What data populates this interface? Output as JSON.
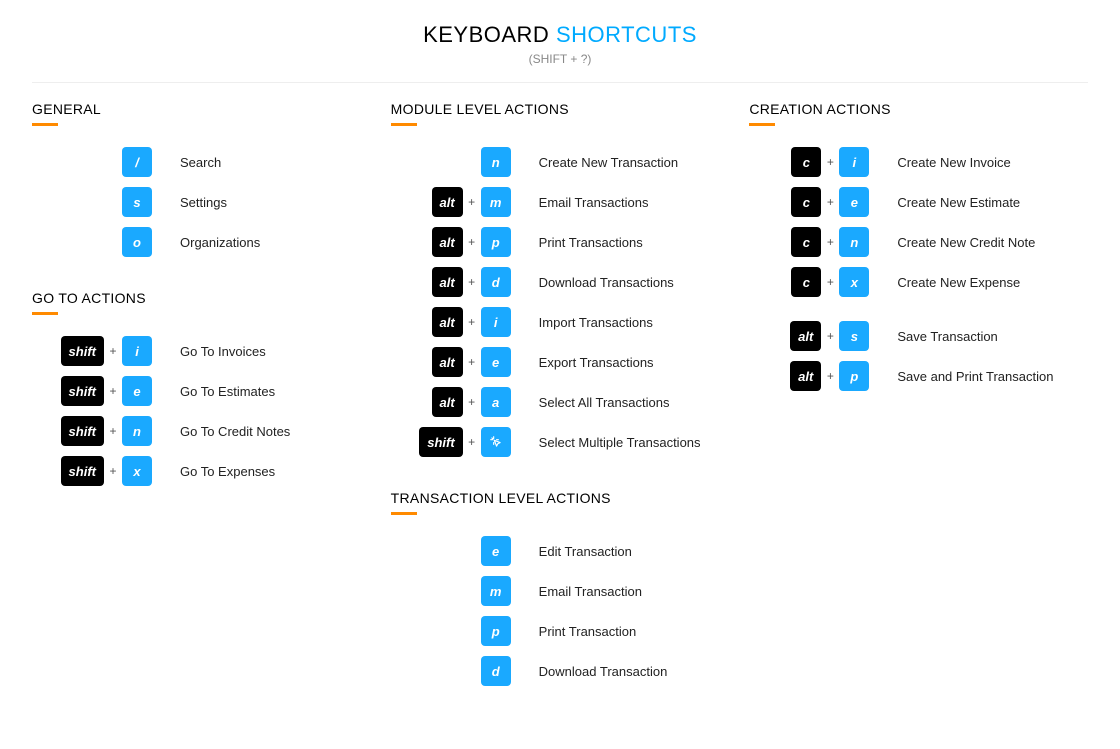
{
  "title_part1": "KEYBOARD ",
  "title_part2": "SHORTCUTS",
  "subtitle": "(SHIFT + ?)",
  "plus": "+",
  "keys": {
    "shift": "shift",
    "alt": "alt",
    "c": "c",
    "slash": "/",
    "s": "s",
    "o": "o",
    "i": "i",
    "e": "e",
    "n": "n",
    "x": "x",
    "m": "m",
    "p": "p",
    "d": "d",
    "a": "a"
  },
  "sections": {
    "general": {
      "title": "GENERAL",
      "items": [
        {
          "label": "Search"
        },
        {
          "label": "Settings"
        },
        {
          "label": "Organizations"
        }
      ]
    },
    "goto": {
      "title": "GO TO ACTIONS",
      "items": [
        {
          "label": "Go To Invoices"
        },
        {
          "label": "Go To Estimates"
        },
        {
          "label": "Go To Credit Notes"
        },
        {
          "label": "Go To Expenses"
        }
      ]
    },
    "module": {
      "title": "MODULE LEVEL ACTIONS",
      "items": [
        {
          "label": "Create New Transaction"
        },
        {
          "label": "Email Transactions"
        },
        {
          "label": "Print Transactions"
        },
        {
          "label": "Download Transactions"
        },
        {
          "label": "Import Transactions"
        },
        {
          "label": "Export Transactions"
        },
        {
          "label": "Select All Transactions"
        },
        {
          "label": "Select Multiple Transactions"
        }
      ]
    },
    "transaction": {
      "title": "TRANSACTION LEVEL ACTIONS",
      "items": [
        {
          "label": "Edit Transaction"
        },
        {
          "label": "Email Transaction"
        },
        {
          "label": "Print Transaction"
        },
        {
          "label": "Download Transaction"
        }
      ]
    },
    "creation": {
      "title": "CREATION ACTIONS",
      "items": [
        {
          "label": "Create New Invoice"
        },
        {
          "label": "Create New Estimate"
        },
        {
          "label": "Create New Credit Note"
        },
        {
          "label": "Create New Expense"
        },
        {
          "label": "Save Transaction"
        },
        {
          "label": "Save and Print Transaction"
        }
      ]
    }
  }
}
